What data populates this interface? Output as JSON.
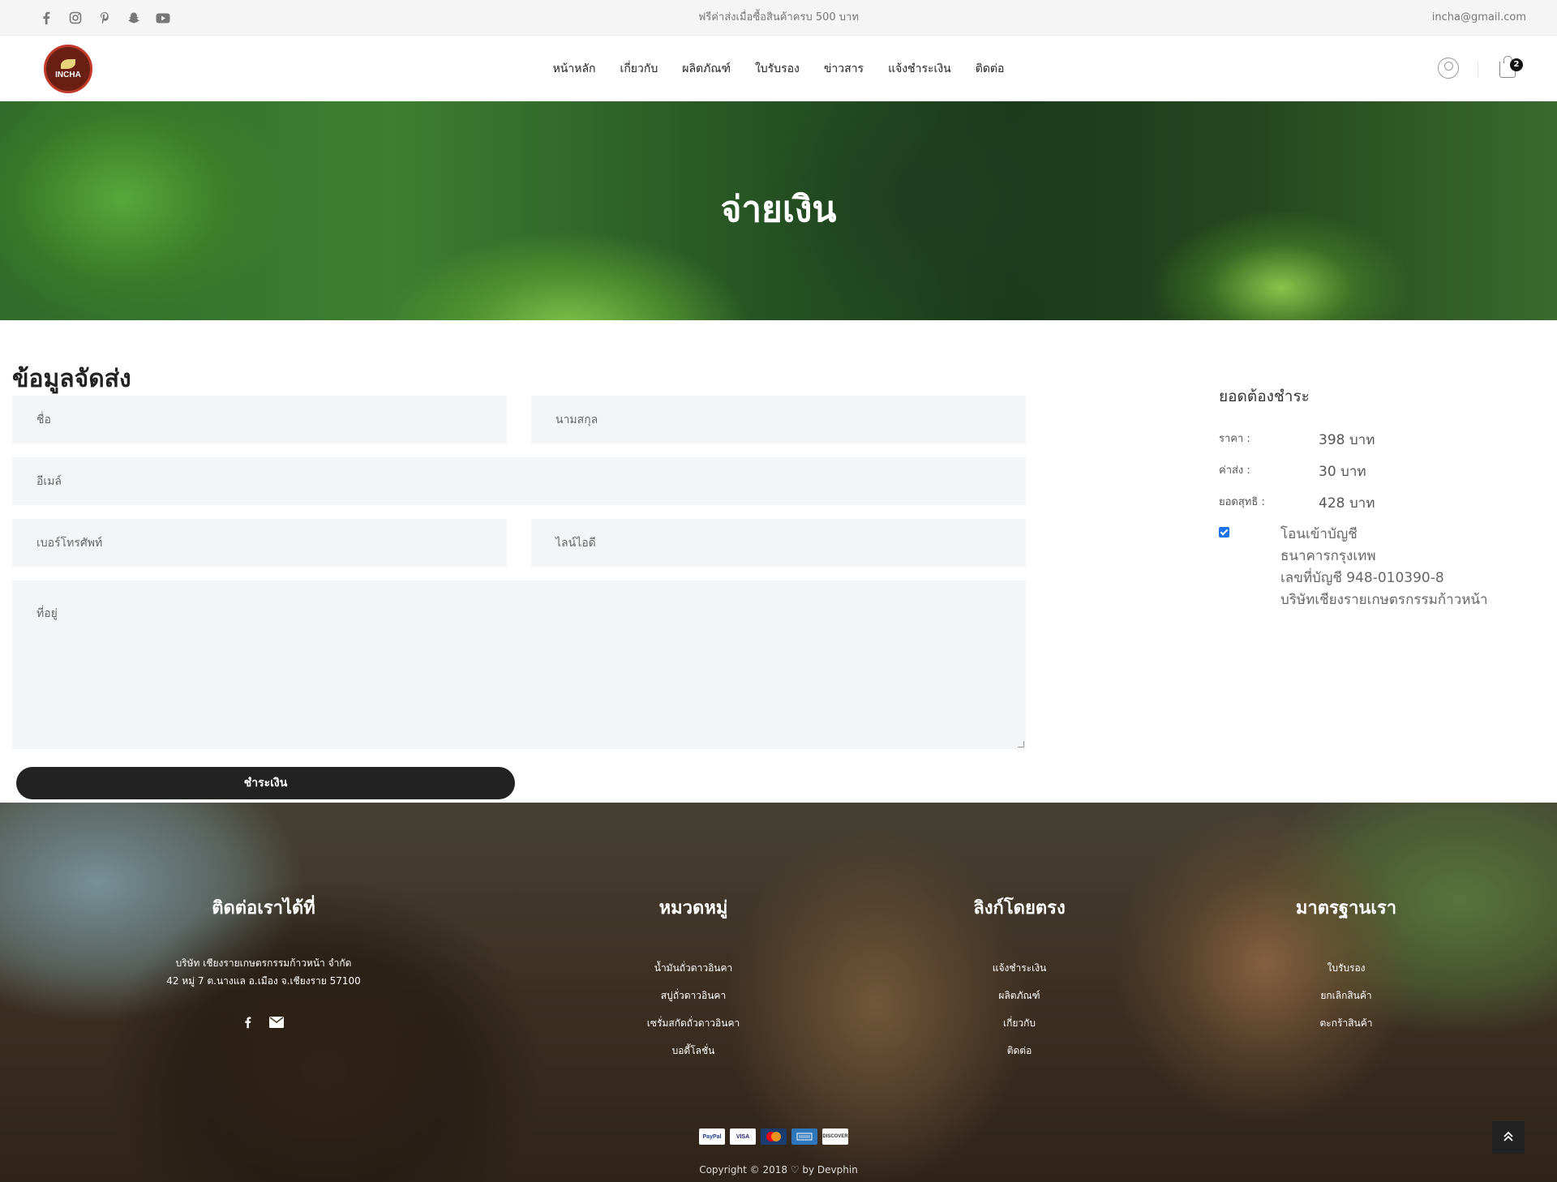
{
  "topbar": {
    "socials": [
      "facebook-icon",
      "instagram-icon",
      "pinterest-icon",
      "snapchat-icon",
      "youtube-icon"
    ],
    "promo": "ฟรีค่าส่งเมื่อซื้อสินค้าครบ 500 บาท",
    "email": "incha@gmail.com"
  },
  "header": {
    "logo_text": "INCHA",
    "nav": [
      "หน้าหลัก",
      "เกี่ยวกับ",
      "ผลิตภัณฑ์",
      "ใบรับรอง",
      "ข่าวสาร",
      "แจ้งชำระเงิน",
      "ติดต่อ"
    ],
    "cart_count": "2"
  },
  "hero": {
    "title": "จ่ายเงิน"
  },
  "form": {
    "title": "ข้อมูลจัดส่ง",
    "first_name": "ชื่อ",
    "last_name": "นามสกุล",
    "email": "อีเมล์",
    "phone": "เบอร์โทรศัพท์",
    "line_id": "ไลน์ไอดี",
    "address": "ที่อยู่",
    "submit": "ชำระเงิน"
  },
  "summary": {
    "title": "ยอดต้องชำระ",
    "rows": [
      {
        "label": "ราคา :",
        "value": "398 บาท"
      },
      {
        "label": "ค่าส่ง :",
        "value": "30 บาท"
      },
      {
        "label": "ยอดสุทธิ :",
        "value": "428 บาท"
      }
    ],
    "payment": {
      "checked": true,
      "lines": [
        "โอนเข้าบัญชี",
        "ธนาคารกรุงเทพ",
        "เลขที่บัญชี 948-010390-8",
        "บริษัทเชียงรายเกษตรกรรมก้าวหน้า"
      ]
    }
  },
  "footer": {
    "contact": {
      "title": "ติดต่อเราได้ที่",
      "line1": "บริษัท เชียงรายเกษตรกรรมก้าวหน้า จำกัด",
      "line2": "42 หมู่ 7 ต.นางแล อ.เมือง จ.เชียงราย 57100"
    },
    "categories": {
      "title": "หมวดหมู่",
      "items": [
        "น้ำมันถั่วดาวอินคา",
        "สบู่ถั่วดาวอินคา",
        "เซรั่มสกัดถั่วดาวอินคา",
        "บอดี้โลชั่น"
      ]
    },
    "links": {
      "title": "ลิงก์โดยตรง",
      "items": [
        "แจ้งชำระเงิน",
        "ผลิตภัณฑ์",
        "เกี่ยวกับ",
        "ติดต่อ"
      ]
    },
    "standards": {
      "title": "มาตรฐานเรา",
      "items": [
        "ใบรับรอง",
        "ยกเลิกสินค้า",
        "ตะกร้าสินค้า"
      ]
    },
    "cards": [
      "PayPal",
      "VISA",
      "MasterCard",
      "AmEx",
      "DISCOVER"
    ],
    "copyright": "Copyright © 2018 ♡ by Devphin"
  },
  "colors": {
    "button": "#222222",
    "field_bg": "#f4f5f9",
    "topbar_bg": "#f5f5f5"
  }
}
